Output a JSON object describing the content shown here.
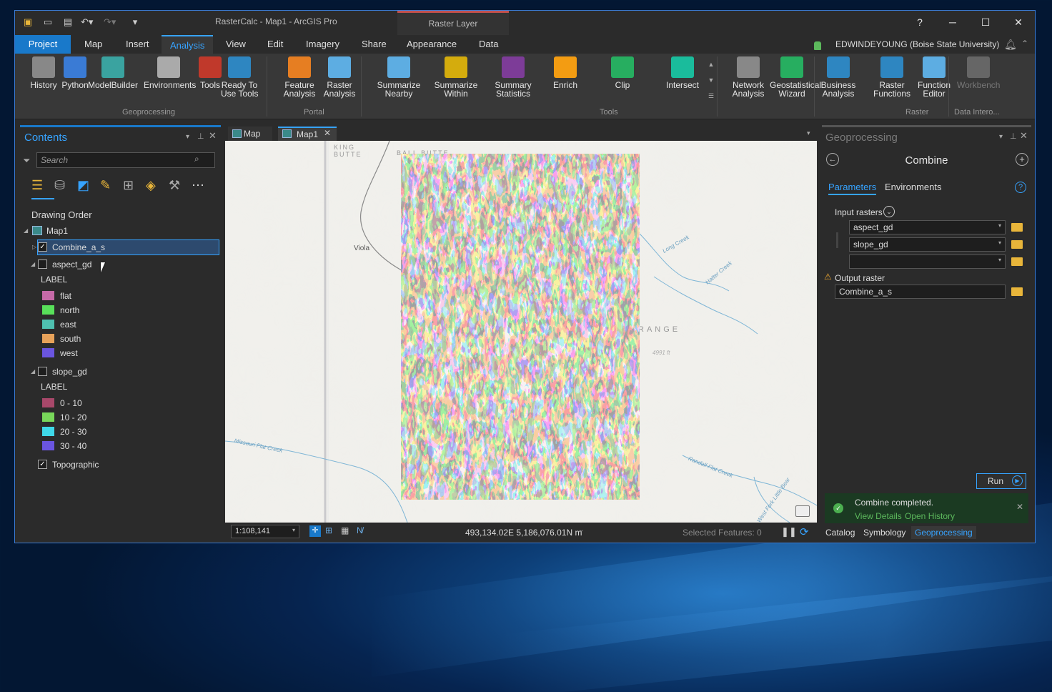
{
  "window": {
    "title": "RasterCalc - Map1 - ArcGIS Pro",
    "context_tab": "Raster Layer",
    "user": "EDWINDEYOUNG (Boise State University)"
  },
  "quick_access": [
    "new-project-icon",
    "open-icon",
    "save-icon",
    "undo-icon",
    "redo-icon",
    "customize-icon"
  ],
  "tabs": [
    "Project",
    "Map",
    "Insert",
    "Analysis",
    "View",
    "Edit",
    "Imagery",
    "Share",
    "Appearance",
    "Data"
  ],
  "ribbon": {
    "groups": [
      "Geoprocessing",
      "Portal",
      "Tools",
      "Raster",
      "Data Intero..."
    ],
    "buttons": [
      "History",
      "Python",
      "ModelBuilder",
      "Environments",
      "Tools",
      "Ready To\nUse Tools",
      "Feature\nAnalysis",
      "Raster\nAnalysis",
      "Summarize\nNearby",
      "Summarize\nWithin",
      "Summary\nStatistics",
      "Enrich",
      "Clip",
      "Intersect",
      "Network\nAnalysis",
      "Geostatistical\nWizard",
      "Business\nAnalysis",
      "Raster\nFunctions",
      "Function\nEditor",
      "Workbench"
    ]
  },
  "contents": {
    "title": "Contents",
    "search_placeholder": "Search",
    "drawing_order": "Drawing Order",
    "map": "Map1",
    "layers": [
      {
        "name": "Combine_a_s",
        "checked": true,
        "selected": true
      },
      {
        "name": "aspect_gd",
        "checked": false,
        "label_header": "LABEL",
        "legend": [
          {
            "label": "flat",
            "color": "#c66aa8"
          },
          {
            "label": "north",
            "color": "#58e05a"
          },
          {
            "label": "east",
            "color": "#4fc0b0"
          },
          {
            "label": "south",
            "color": "#e7a25a"
          },
          {
            "label": "west",
            "color": "#6a55e0"
          }
        ]
      },
      {
        "name": "slope_gd",
        "checked": false,
        "label_header": "LABEL",
        "legend": [
          {
            "label": "0 - 10",
            "color": "#a8486a"
          },
          {
            "label": "10 - 20",
            "color": "#78d85a"
          },
          {
            "label": "20 - 30",
            "color": "#3fd8e8"
          },
          {
            "label": "30 - 40",
            "color": "#6a55e0"
          }
        ]
      },
      {
        "name": "Topographic",
        "checked": true
      }
    ]
  },
  "map": {
    "tabs": [
      "Map",
      "Map1"
    ],
    "labels": [
      "KING\nBUTTE",
      "BALL BUTTE",
      "Viola",
      "RANGE",
      "4991 ft",
      "Long Creek",
      "Hatter Creek",
      "Missouri Flat Creek",
      "Randall Flat Creek",
      "West Fork Little Bear"
    ],
    "status": {
      "scale": "1:108,141",
      "coords": "493,134.02E 5,186,076.01N m",
      "selected": "Selected Features: 0"
    }
  },
  "geoprocessing": {
    "title": "Geoprocessing",
    "tool": "Combine",
    "tab_parameters": "Parameters",
    "tab_env": "Environments",
    "input_label": "Input rasters",
    "inputs": [
      "aspect_gd",
      "slope_gd",
      ""
    ],
    "output_label": "Output raster",
    "output": "Combine_a_s",
    "run": "Run",
    "msg": "Combine completed.",
    "view_details": "View Details",
    "open_history": "Open History",
    "bottom_tabs": [
      "Catalog",
      "Symbology",
      "Geoprocessing"
    ]
  },
  "colors": {
    "accent": "#1979ca",
    "link": "#36a3ff",
    "success": "#2e7d32",
    "warning": "#f0a830"
  }
}
